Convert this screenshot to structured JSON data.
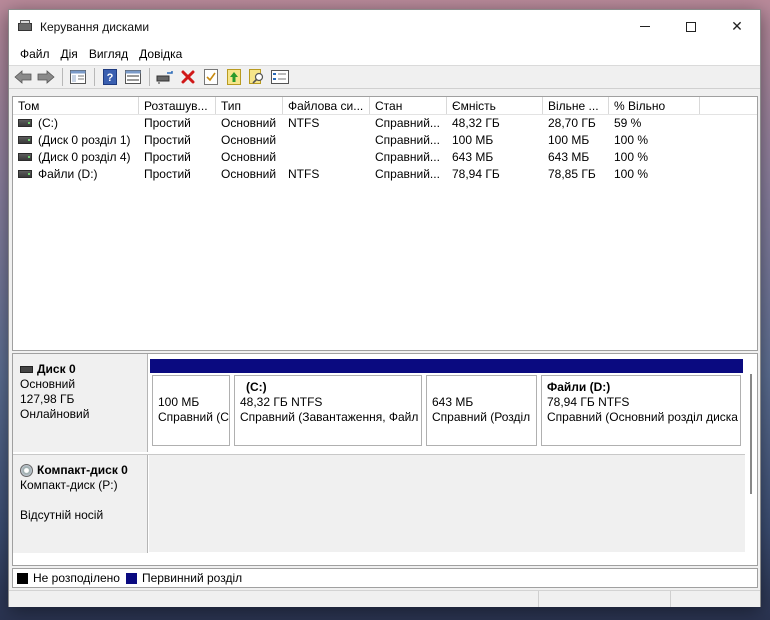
{
  "window": {
    "title": "Керування дисками"
  },
  "menu": [
    "Файл",
    "Дія",
    "Вигляд",
    "Довідка"
  ],
  "toolbar": [
    "back-icon",
    "forward-icon",
    "console-tree-icon",
    "help-icon",
    "properties-icon",
    "connect-icon",
    "delete-icon",
    "check-icon",
    "export-icon",
    "search-icon",
    "details-icon"
  ],
  "list": {
    "columns": [
      "Том",
      "Розташув...",
      "Тип",
      "Файлова си...",
      "Стан",
      "Ємність",
      "Вільне ...",
      "% Вільно"
    ],
    "rows": [
      [
        "(C:)",
        "Простий",
        "Основний",
        "NTFS",
        "Справний...",
        "48,32 ГБ",
        "28,70 ГБ",
        "59 %"
      ],
      [
        "(Диск 0 розділ 1)",
        "Простий",
        "Основний",
        "",
        "Справний...",
        "100 МБ",
        "100 МБ",
        "100 %"
      ],
      [
        "(Диск 0 розділ 4)",
        "Простий",
        "Основний",
        "",
        "Справний...",
        "643 МБ",
        "643 МБ",
        "100 %"
      ],
      [
        "Файли (D:)",
        "Простий",
        "Основний",
        "NTFS",
        "Справний...",
        "78,94 ГБ",
        "78,85 ГБ",
        "100 %"
      ]
    ]
  },
  "disk0": {
    "name": "Диск 0",
    "type": "Основний",
    "size": "127,98 ГБ",
    "status": "Онлайновий",
    "partitions": [
      {
        "label": "",
        "size": "100 МБ",
        "status": "Справний (С"
      },
      {
        "label": "(C:)",
        "size": "48,32 ГБ NTFS",
        "status": "Справний (Завантаження, Файл"
      },
      {
        "label": "",
        "size": "643 МБ",
        "status": "Справний (Розділ"
      },
      {
        "label": "Файли  (D:)",
        "size": "78,94 ГБ NTFS",
        "status": "Справний (Основний розділ диска"
      }
    ]
  },
  "cdrom0": {
    "name": "Компакт-диск 0",
    "type": "Компакт-диск (P:)",
    "status": "Відсутній носій"
  },
  "legend": {
    "unallocated": "Не розподілено",
    "primary": "Первинний розділ",
    "unallocated_color": "#000000",
    "primary_color": "#0a0a80"
  }
}
